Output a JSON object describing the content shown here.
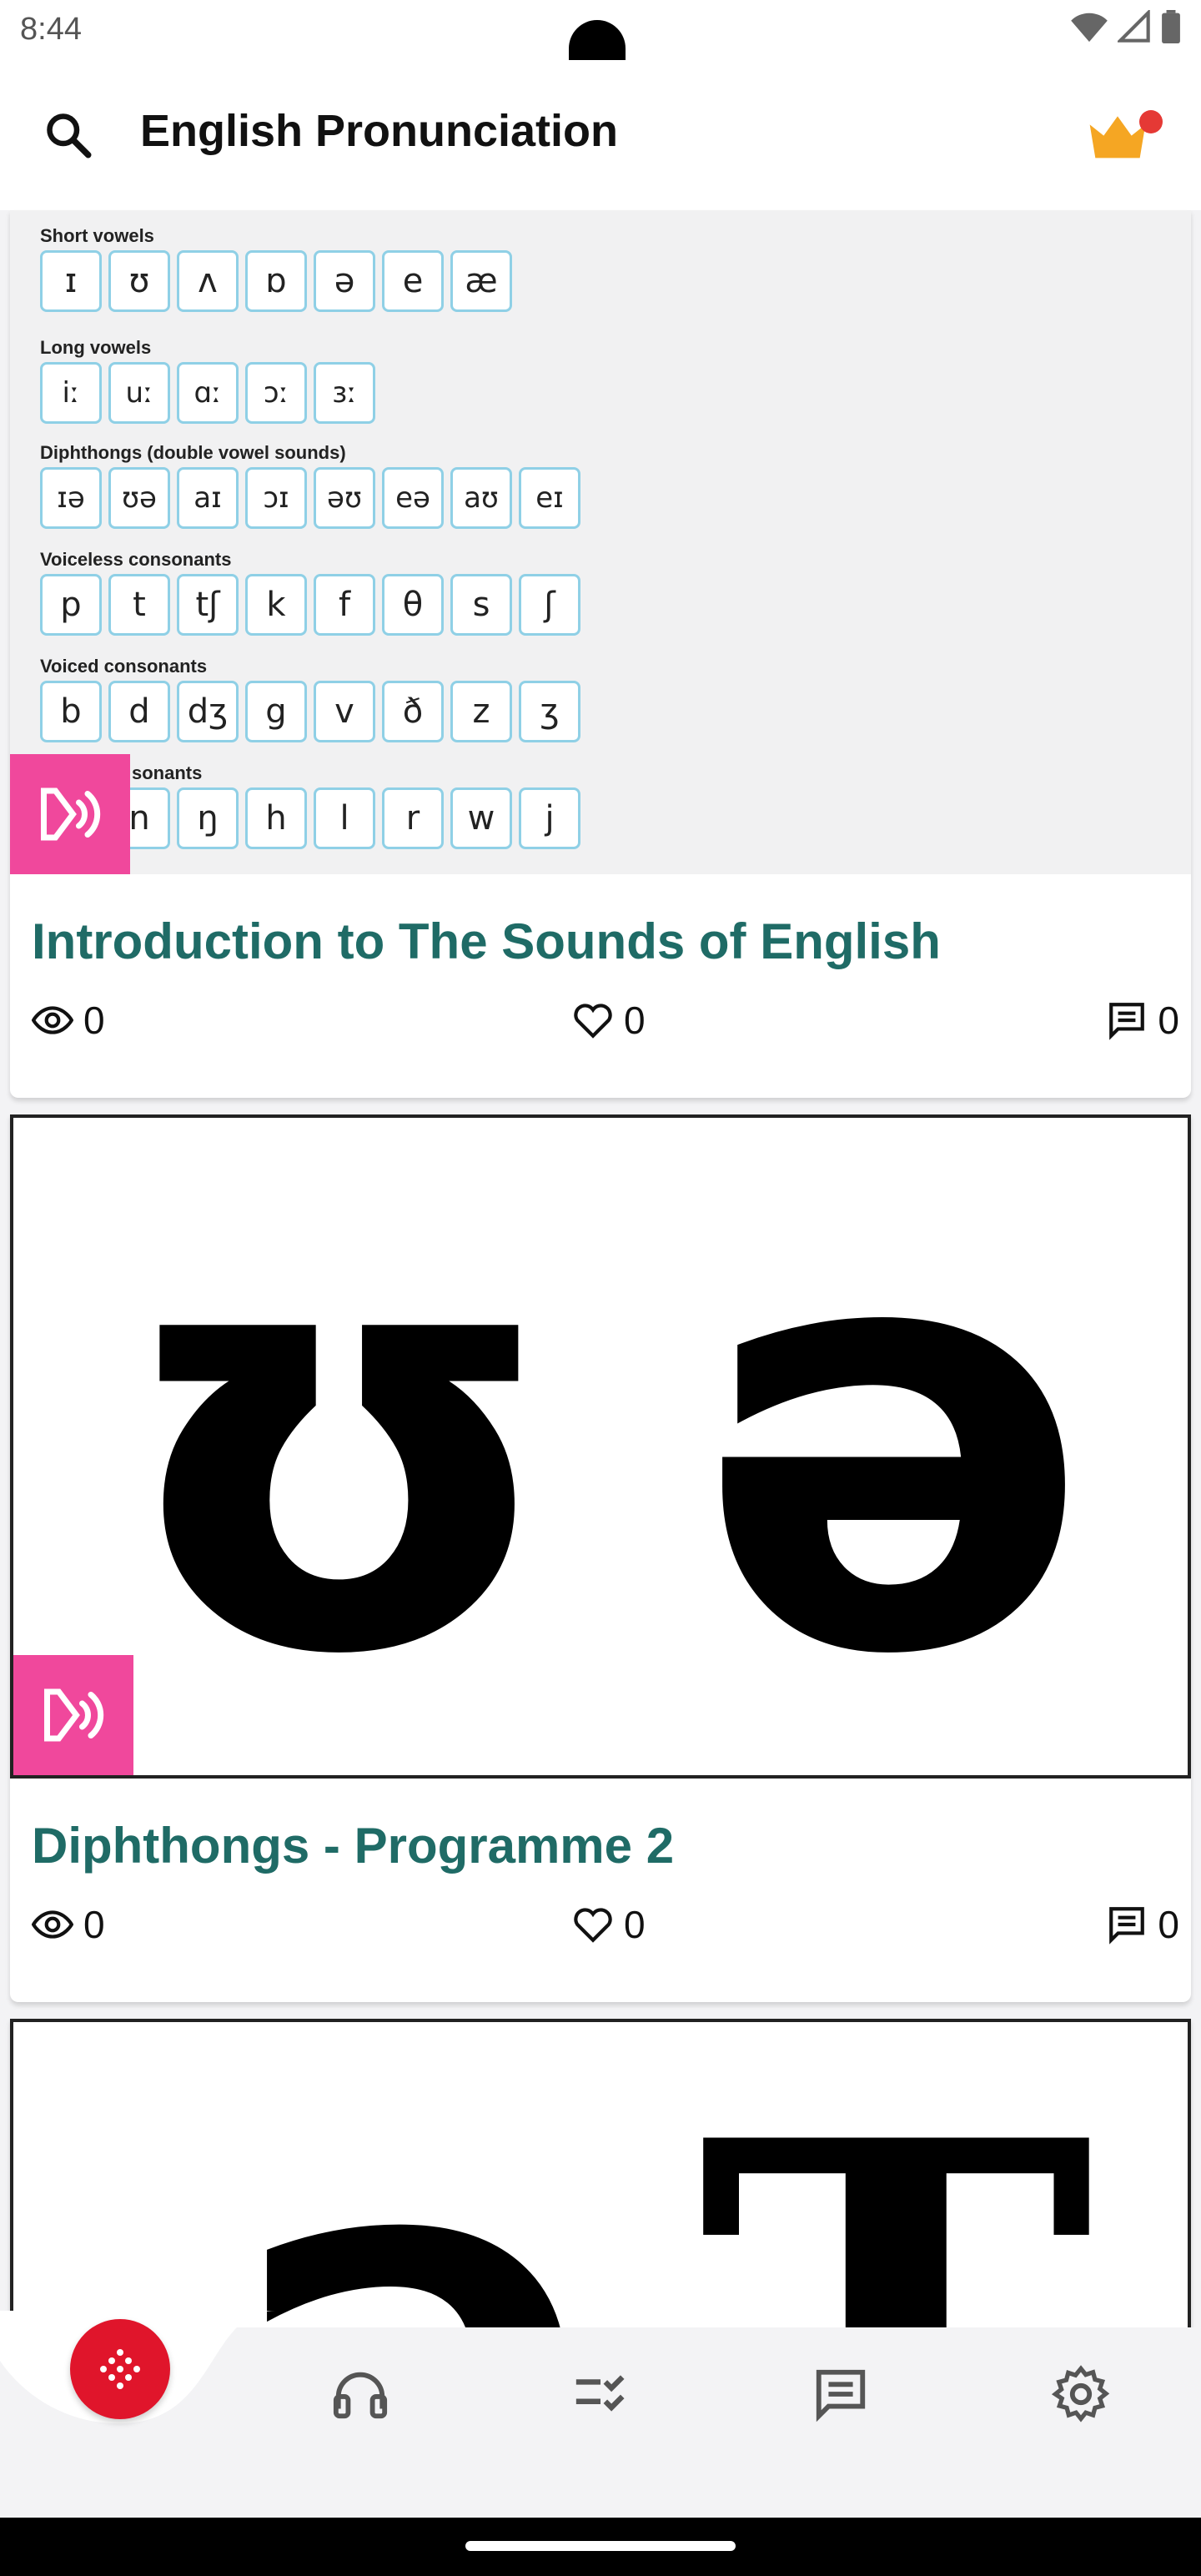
{
  "status_bar": {
    "time": "8:44"
  },
  "app_bar": {
    "title": "English Pronunciation"
  },
  "cards": [
    {
      "title": "Introduction to The Sounds of English",
      "views": "0",
      "likes": "0",
      "comments": "0",
      "chart": {
        "short_vowels_label": "Short vowels",
        "short_vowels": [
          "ɪ",
          "ʊ",
          "ʌ",
          "ɒ",
          "ə",
          "e",
          "æ"
        ],
        "long_vowels_label": "Long vowels",
        "long_vowels": [
          "iː",
          "uː",
          "ɑː",
          "ɔː",
          "ɜː"
        ],
        "diphthongs_label": "Diphthongs (double vowel sounds)",
        "diphthongs": [
          "ɪə",
          "ʊə",
          "aɪ",
          "ɔɪ",
          "əʊ",
          "eə",
          "aʊ",
          "eɪ"
        ],
        "voiceless_label": "Voiceless consonants",
        "voiceless": [
          "p",
          "t",
          "tʃ",
          "k",
          "f",
          "θ",
          "s",
          "ʃ"
        ],
        "voiced_label": "Voiced consonants",
        "voiced": [
          "b",
          "d",
          "dʒ",
          "g",
          "v",
          "ð",
          "z",
          "ʒ"
        ],
        "other_label_partial": "sonants",
        "other": [
          "n",
          "ŋ",
          "h",
          "l",
          "r",
          "w",
          "j"
        ]
      }
    },
    {
      "title": "Diphthongs - Programme 2",
      "views": "0",
      "likes": "0",
      "comments": "0",
      "symbol_left": "ʊ",
      "symbol_right": "ə"
    },
    {
      "symbol_left": "ə",
      "symbol_right": "T"
    }
  ],
  "colors": {
    "title": "#1f6b66",
    "badge": "#f0489c",
    "fab": "#e0152b",
    "crown": "#f5a623"
  },
  "nav_icons": [
    "apps-icon",
    "headphones-icon",
    "checklist-icon",
    "chat-icon",
    "settings-icon"
  ]
}
